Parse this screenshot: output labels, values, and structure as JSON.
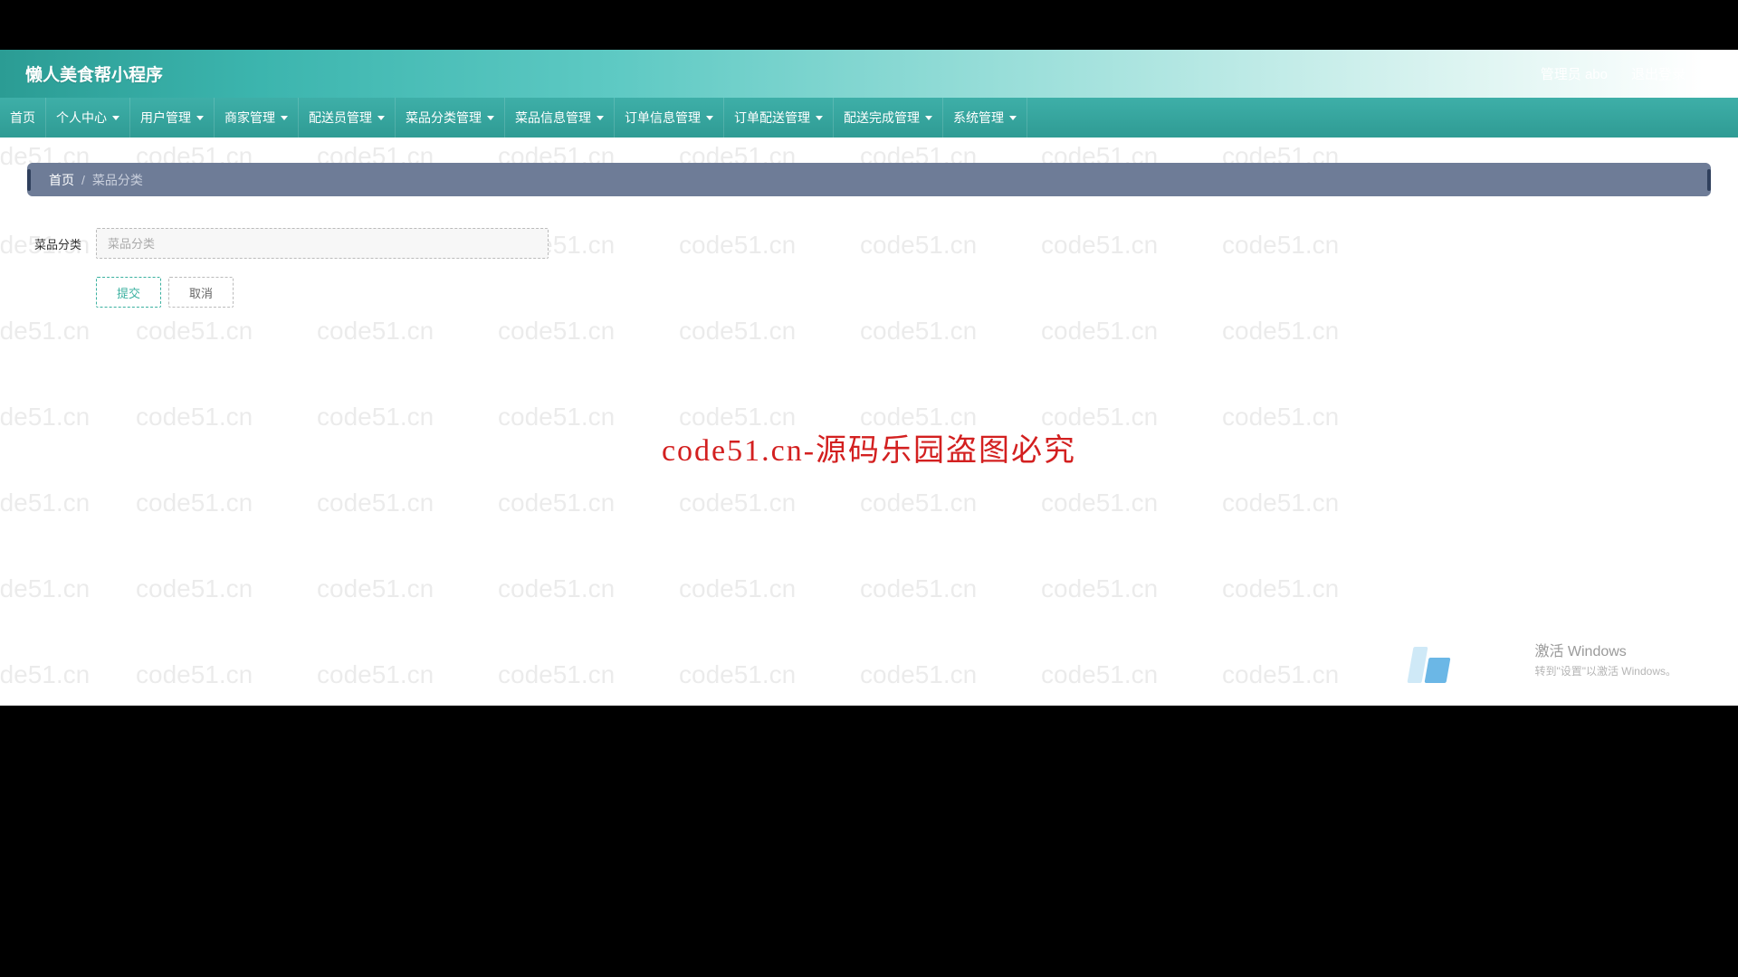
{
  "header": {
    "app_title": "懒人美食帮小程序",
    "admin_label": "管理员 abo",
    "logout_label": "退出登录"
  },
  "nav": {
    "items": [
      {
        "label": "首页",
        "dropdown": false
      },
      {
        "label": "个人中心",
        "dropdown": true
      },
      {
        "label": "用户管理",
        "dropdown": true
      },
      {
        "label": "商家管理",
        "dropdown": true
      },
      {
        "label": "配送员管理",
        "dropdown": true
      },
      {
        "label": "菜品分类管理",
        "dropdown": true
      },
      {
        "label": "菜品信息管理",
        "dropdown": true
      },
      {
        "label": "订单信息管理",
        "dropdown": true
      },
      {
        "label": "订单配送管理",
        "dropdown": true
      },
      {
        "label": "配送完成管理",
        "dropdown": true
      },
      {
        "label": "系统管理",
        "dropdown": true
      }
    ]
  },
  "breadcrumb": {
    "home": "首页",
    "separator": "/",
    "current": "菜品分类"
  },
  "form": {
    "category_label": "菜品分类",
    "category_placeholder": "菜品分类",
    "category_value": "",
    "submit_label": "提交",
    "cancel_label": "取消"
  },
  "overlay": {
    "center_text": "code51.cn-源码乐园盗图必究",
    "watermark_text": "code51.cn",
    "activation_line1": "激活 Windows",
    "activation_line2": "转到\"设置\"以激活 Windows。"
  }
}
